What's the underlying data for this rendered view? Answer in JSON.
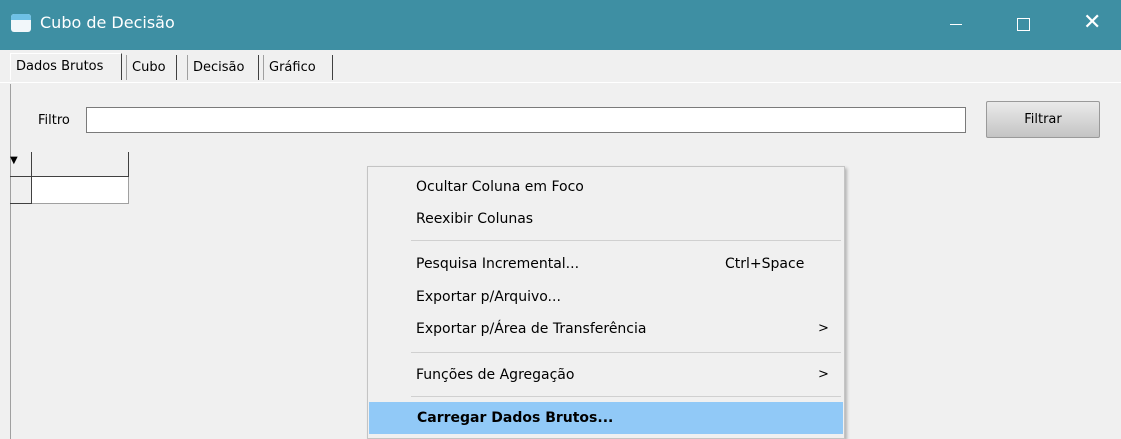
{
  "window": {
    "title": "Cubo de Decisão"
  },
  "tabs": [
    {
      "label": "Dados Brutos",
      "active": true
    },
    {
      "label": "Cubo",
      "active": false
    },
    {
      "label": "Decisão",
      "active": false
    },
    {
      "label": "Gráfico",
      "active": false
    }
  ],
  "filter": {
    "label": "Filtro",
    "value": "",
    "button_label": "Filtrar"
  },
  "grid": {
    "indicator_glyph": "▼"
  },
  "context_menu": {
    "items": [
      {
        "label": "Ocultar Coluna em Foco"
      },
      {
        "label": "Reexibir Colunas"
      },
      {
        "label": "Pesquisa Incremental...",
        "shortcut": "Ctrl+Space"
      },
      {
        "label": "Exportar p/Arquivo..."
      },
      {
        "label": "Exportar p/Área de Transferência",
        "submenu": ">"
      },
      {
        "label": "Funções de Agregação",
        "submenu": ">"
      },
      {
        "label": "Carregar Dados Brutos...",
        "highlighted": true
      }
    ]
  },
  "colors": {
    "titlebar": "#3e8fa3",
    "menu_highlight": "#91c9f7"
  }
}
